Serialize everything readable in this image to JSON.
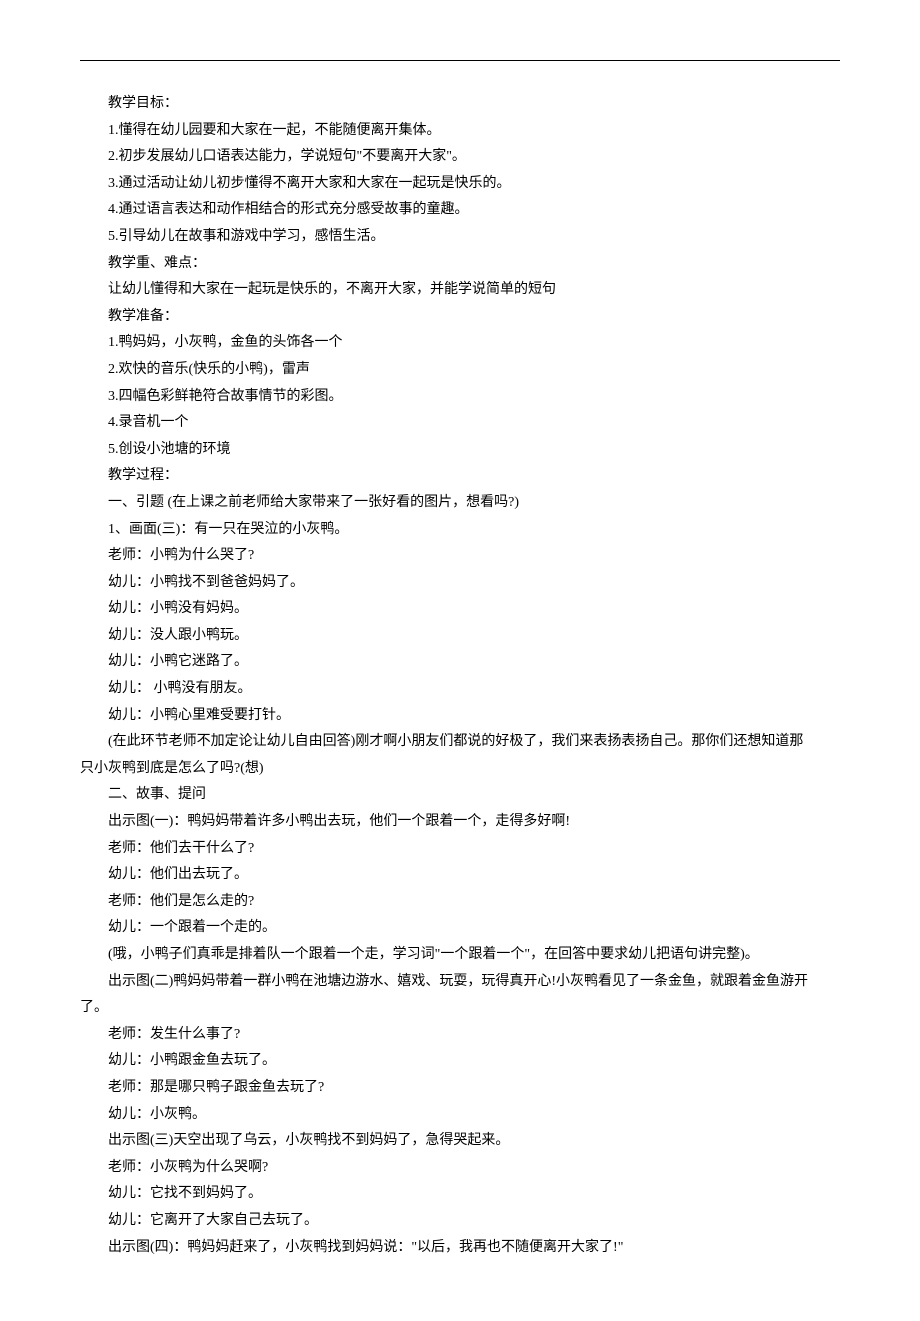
{
  "lines": [
    "教学目标：",
    "1.懂得在幼儿园要和大家在一起，不能随便离开集体。",
    "2.初步发展幼儿口语表达能力，学说短句\"不要离开大家\"。",
    "3.通过活动让幼儿初步懂得不离开大家和大家在一起玩是快乐的。",
    "4.通过语言表达和动作相结合的形式充分感受故事的童趣。",
    "5.引导幼儿在故事和游戏中学习，感悟生活。",
    "教学重、难点：",
    "让幼儿懂得和大家在一起玩是快乐的，不离开大家，并能学说简单的短句",
    "教学准备：",
    "1.鸭妈妈，小灰鸭，金鱼的头饰各一个",
    "2.欢快的音乐(快乐的小鸭)，雷声",
    "3.四幅色彩鲜艳符合故事情节的彩图。",
    "4.录音机一个",
    "5.创设小池塘的环境",
    "教学过程：",
    "一、引题 (在上课之前老师给大家带来了一张好看的图片，想看吗?)",
    "1、画面(三)：有一只在哭泣的小灰鸭。",
    "老师：小鸭为什么哭了?",
    "幼儿：小鸭找不到爸爸妈妈了。",
    "幼儿：小鸭没有妈妈。",
    "幼儿：没人跟小鸭玩。",
    "幼儿：小鸭它迷路了。",
    "幼儿：  小鸭没有朋友。",
    "幼儿：小鸭心里难受要打针。",
    {
      "type": "wrap",
      "first": "(在此环节老师不加定论让幼儿自由回答)刚才啊小朋友们都说的好极了，我们来表扬表扬自己。那你们还想知道那",
      "rest": "只小灰鸭到底是怎么了吗?(想)"
    },
    "二、故事、提问",
    "出示图(一)：鸭妈妈带着许多小鸭出去玩，他们一个跟着一个，走得多好啊!",
    "老师：他们去干什么了?",
    "幼儿：他们出去玩了。",
    "老师：他们是怎么走的?",
    "幼儿：一个跟着一个走的。",
    "(哦，小鸭子们真乖是排着队一个跟着一个走，学习词\"一个跟着一个\"，在回答中要求幼儿把语句讲完整)。",
    {
      "type": "wrap",
      "first": "出示图(二)鸭妈妈带着一群小鸭在池塘边游水、嬉戏、玩耍，玩得真开心!小灰鸭看见了一条金鱼，就跟着金鱼游开",
      "rest": "了。"
    },
    "老师：发生什么事了?",
    "幼儿：小鸭跟金鱼去玩了。",
    "老师：那是哪只鸭子跟金鱼去玩了?",
    "幼儿：小灰鸭。",
    "出示图(三)天空出现了乌云，小灰鸭找不到妈妈了，急得哭起来。",
    "老师：小灰鸭为什么哭啊?",
    "幼儿：它找不到妈妈了。",
    "幼儿：它离开了大家自己去玩了。",
    "出示图(四)：鸭妈妈赶来了，小灰鸭找到妈妈说：\"以后，我再也不随便离开大家了!\""
  ]
}
